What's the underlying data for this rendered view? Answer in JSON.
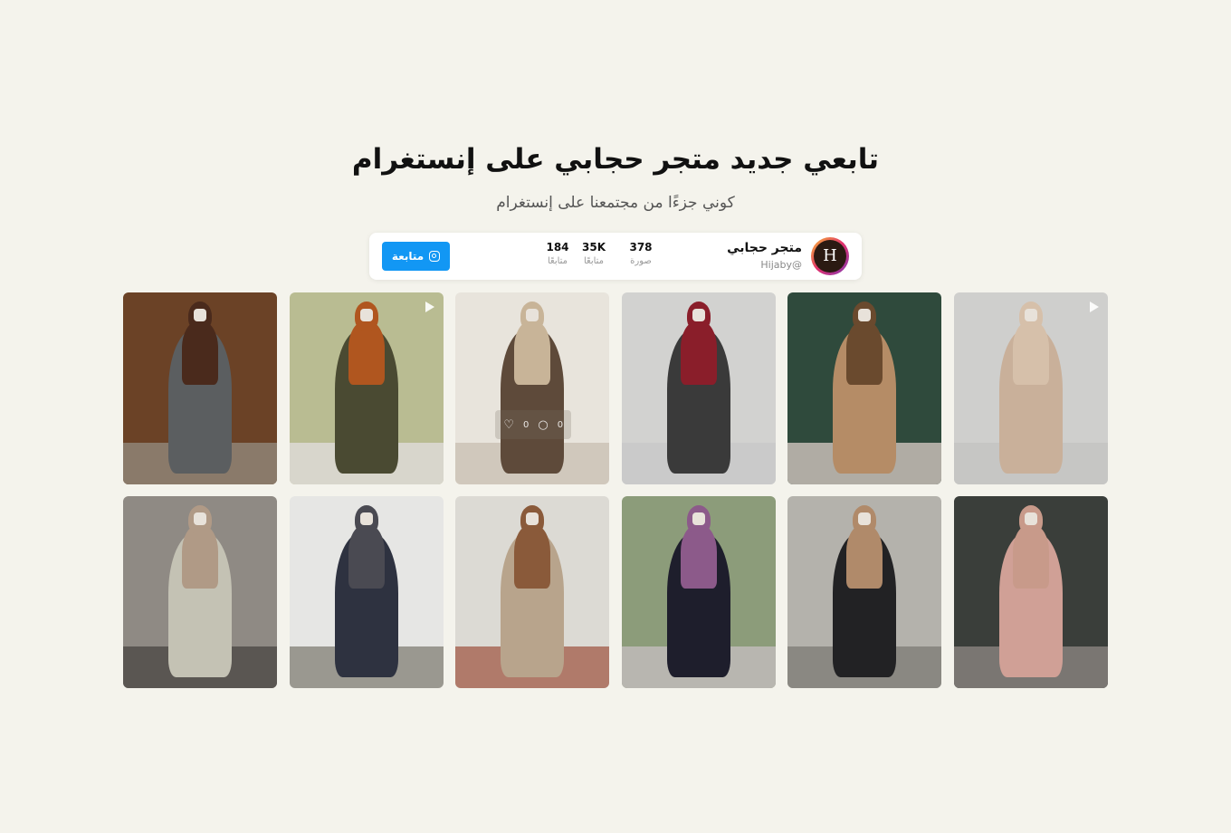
{
  "header": {
    "title": "تابعي جديد متجر حجابي على إنستغرام",
    "subtitle": "كوني جزءًا من مجتمعنا على إنستغرام"
  },
  "profile": {
    "avatar_letter": "H",
    "name": "متجر حجابي",
    "handle": "Hijaby@",
    "stats": [
      {
        "value": "378",
        "label": "صورة"
      },
      {
        "value": "35K",
        "label": "متابعًا"
      },
      {
        "value": "184",
        "label": "متابعًا"
      }
    ],
    "follow_label": "متابعة",
    "follow_icon": "instagram-icon",
    "button_color": "#1297f4"
  },
  "posts": [
    {
      "type": "image",
      "bg": "#6b4226",
      "garment": "#5b5e60",
      "scarf": "#4a2a1c",
      "floor": "#8a7a6a"
    },
    {
      "type": "video",
      "bg": "#b9bc92",
      "garment": "#4a4a32",
      "scarf": "#b0561f",
      "floor": "#d8d6cc"
    },
    {
      "type": "image",
      "bg": "#e8e4dc",
      "garment": "#5e4a3a",
      "scarf": "#c8b498",
      "floor": "#d0c8bc",
      "likes": "0",
      "comments": "0"
    },
    {
      "type": "image",
      "bg": "#d2d2d0",
      "garment": "#3a3a3a",
      "scarf": "#8a1e2a",
      "floor": "#cacaca"
    },
    {
      "type": "image",
      "bg": "#2f4a3c",
      "garment": "#b58c66",
      "scarf": "#6a4a2e",
      "floor": "#b0aca4"
    },
    {
      "type": "video",
      "bg": "#cfcfcd",
      "garment": "#c9b09a",
      "scarf": "#d6c0aa",
      "floor": "#c6c6c4"
    },
    {
      "type": "image",
      "bg": "#8f8a84",
      "garment": "#c4c2b4",
      "scarf": "#b09a86",
      "floor": "#5a5652"
    },
    {
      "type": "image",
      "bg": "#e6e6e4",
      "garment": "#2e3240",
      "scarf": "#4a4a52",
      "floor": "#9a9890"
    },
    {
      "type": "image",
      "bg": "#dcdad4",
      "garment": "#b8a48c",
      "scarf": "#8a5a3a",
      "floor": "#b07a6a"
    },
    {
      "type": "image",
      "bg": "#8c9c7a",
      "garment": "#1e1e2c",
      "scarf": "#8c5a8a",
      "floor": "#b8b6b0"
    },
    {
      "type": "image",
      "bg": "#b4b2ac",
      "garment": "#222224",
      "scarf": "#b08a6a",
      "floor": "#8a8882"
    },
    {
      "type": "image",
      "bg": "#3a3e3a",
      "garment": "#d0a096",
      "scarf": "#c89a8a",
      "floor": "#7a7672"
    }
  ]
}
